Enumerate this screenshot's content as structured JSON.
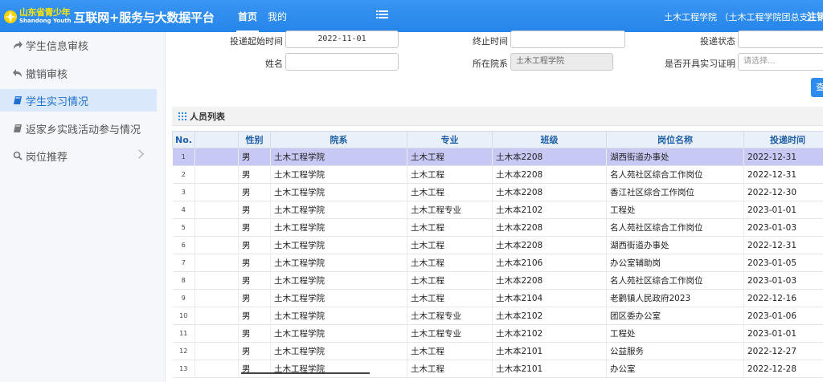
{
  "header": {
    "brand_small_cn": "山东省青少年",
    "brand_small_en": "Shandong  Youth",
    "brand_title": "互联网+服务与大数据平台",
    "tabs": [
      {
        "label": "首页",
        "active": true
      },
      {
        "label": "我的",
        "active": false
      }
    ],
    "menu_icon": "hamburger-icon",
    "user": "土木工程学院 （土木工程学院团总支）",
    "logout": "注销"
  },
  "sidebar": {
    "items": [
      {
        "label": "学生信息审核",
        "icon": "share-arrow-icon",
        "active": false
      },
      {
        "label": "撤销审核",
        "icon": "undo-icon",
        "active": false
      },
      {
        "label": "学生实习情况",
        "icon": "book-icon",
        "active": true
      },
      {
        "label": "返家乡实践活动参与情况",
        "icon": "book-icon",
        "active": false
      },
      {
        "label": "岗位推荐",
        "icon": "search-icon",
        "active": false,
        "has_arrow": true
      }
    ]
  },
  "filters": {
    "start_label": "投递起始时间",
    "start_value": "2022-11-01",
    "end_label": "终止时间",
    "end_value": "",
    "status_label": "投递状态",
    "status_value": "",
    "name_label": "姓名",
    "name_value": "",
    "college_label": "所在院系",
    "college_value": "土木工程学院",
    "cert_label": "是否开具实习证明",
    "cert_placeholder": "请选择...",
    "search_label": "查"
  },
  "list": {
    "title": "人员列表",
    "columns": [
      "No.",
      "",
      "性别",
      "院系",
      "专业",
      "班级",
      "岗位名称",
      "投递时间"
    ],
    "rows": [
      {
        "no": "1",
        "gender": "男",
        "college": "土木工程学院",
        "major": "土木工程",
        "class": "土木本2208",
        "position": "湖西街道办事处",
        "date": "2022-12-31",
        "selected": true
      },
      {
        "no": "2",
        "gender": "男",
        "college": "土木工程学院",
        "major": "土木工程",
        "class": "土木本2208",
        "position": "名人苑社区综合工作岗位",
        "date": "2022-12-31"
      },
      {
        "no": "3",
        "gender": "男",
        "college": "土木工程学院",
        "major": "土木工程",
        "class": "土木本2208",
        "position": "香江社区综合工作岗位",
        "date": "2022-12-30"
      },
      {
        "no": "4",
        "gender": "男",
        "college": "土木工程学院",
        "major": "土木工程专业",
        "class": "土木本2102",
        "position": "工程处",
        "date": "2023-01-01"
      },
      {
        "no": "5",
        "gender": "男",
        "college": "土木工程学院",
        "major": "土木工程",
        "class": "土木本2208",
        "position": "名人苑社区综合工作岗位",
        "date": "2023-01-03"
      },
      {
        "no": "6",
        "gender": "男",
        "college": "土木工程学院",
        "major": "土木工程",
        "class": "土木本2208",
        "position": "湖西街道办事处",
        "date": "2022-12-31"
      },
      {
        "no": "7",
        "gender": "男",
        "college": "土木工程学院",
        "major": "土木工程",
        "class": "土木本2106",
        "position": "办公室辅助岗",
        "date": "2023-01-05"
      },
      {
        "no": "8",
        "gender": "男",
        "college": "土木工程学院",
        "major": "土木工程",
        "class": "土木本2208",
        "position": "名人苑社区综合工作岗位",
        "date": "2023-01-03"
      },
      {
        "no": "9",
        "gender": "男",
        "college": "土木工程学院",
        "major": "土木工程",
        "class": "土木本2104",
        "position": "老鹳镇人民政府2023",
        "date": "2022-12-16"
      },
      {
        "no": "10",
        "gender": "男",
        "college": "土木工程学院",
        "major": "土木工程专业",
        "class": "土木本2102",
        "position": "团区委办公室",
        "date": "2023-01-06"
      },
      {
        "no": "11",
        "gender": "男",
        "college": "土木工程学院",
        "major": "土木工程专业",
        "class": "土木本2102",
        "position": "工程处",
        "date": "2023-01-01"
      },
      {
        "no": "12",
        "gender": "男",
        "college": "土木工程学院",
        "major": "土木工程",
        "class": "土木本2101",
        "position": "公益服务",
        "date": "2022-12-27"
      },
      {
        "no": "13",
        "gender": "男",
        "college": "土木工程学院",
        "major": "土木工程",
        "class": "土木本2101",
        "position": "办公室",
        "date": "2022-12-28"
      }
    ]
  },
  "colors": {
    "header_blue": "#2d8cf0",
    "brand_yellow": "#ffe600",
    "selected_row": "#c8c8f5",
    "sidebar_active": "#d9e9fb"
  }
}
